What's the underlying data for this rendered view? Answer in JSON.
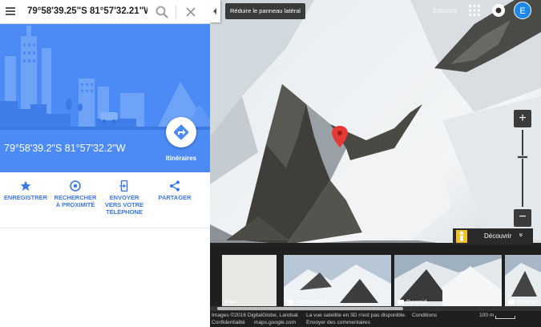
{
  "search": {
    "value": "79°58'39.25\"S 81°57'32.21\"W"
  },
  "place": {
    "coordinates": "79°58'39.2\"S 81°57'32.2\"W",
    "directions_label": "Itinéraires"
  },
  "actions": [
    {
      "label_lines": [
        "ENREGISTRER"
      ],
      "icon": "star-icon"
    },
    {
      "label_lines": [
        "RECHERCHER",
        "À PROXIMITÉ"
      ],
      "icon": "nearby-icon"
    },
    {
      "label_lines": [
        "ENVOYER",
        "VERS VOTRE",
        "TÉLÉPHONE"
      ],
      "icon": "send-to-phone-icon"
    },
    {
      "label_lines": [
        "PARTAGER"
      ],
      "icon": "share-icon"
    }
  ],
  "map": {
    "collapse_tooltip": "Réduire le panneau latéral",
    "user_name": "Edouard",
    "avatar_letter": "E",
    "zoom_in": "+",
    "zoom_out": "−",
    "discover_label": "Découvrir",
    "discover_chevron": "»"
  },
  "filmstrip": {
    "items": [
      {
        "caption": "Plan",
        "camera": false
      },
      {
        "caption": "Pyramid D-3",
        "camera": true
      },
      {
        "caption": "Pyramid",
        "camera": true
      },
      {
        "caption": "Pyramid",
        "camera": true
      }
    ]
  },
  "footer": {
    "copyright": "Images ©2016 DigitalGlobe, Landsat",
    "satellite_notice": "La vue satellite en 3D n'est pas disponible.",
    "terms": "Conditions",
    "privacy": "Confidentialité",
    "domain": "maps.google.com",
    "feedback": "Envoyer des commentaires",
    "scale": "100 m"
  },
  "colors": {
    "accent": "#4c8bf5",
    "link_blue": "#3b78e7",
    "marker_red": "#e53935",
    "avatar_blue": "#1e88e5"
  }
}
